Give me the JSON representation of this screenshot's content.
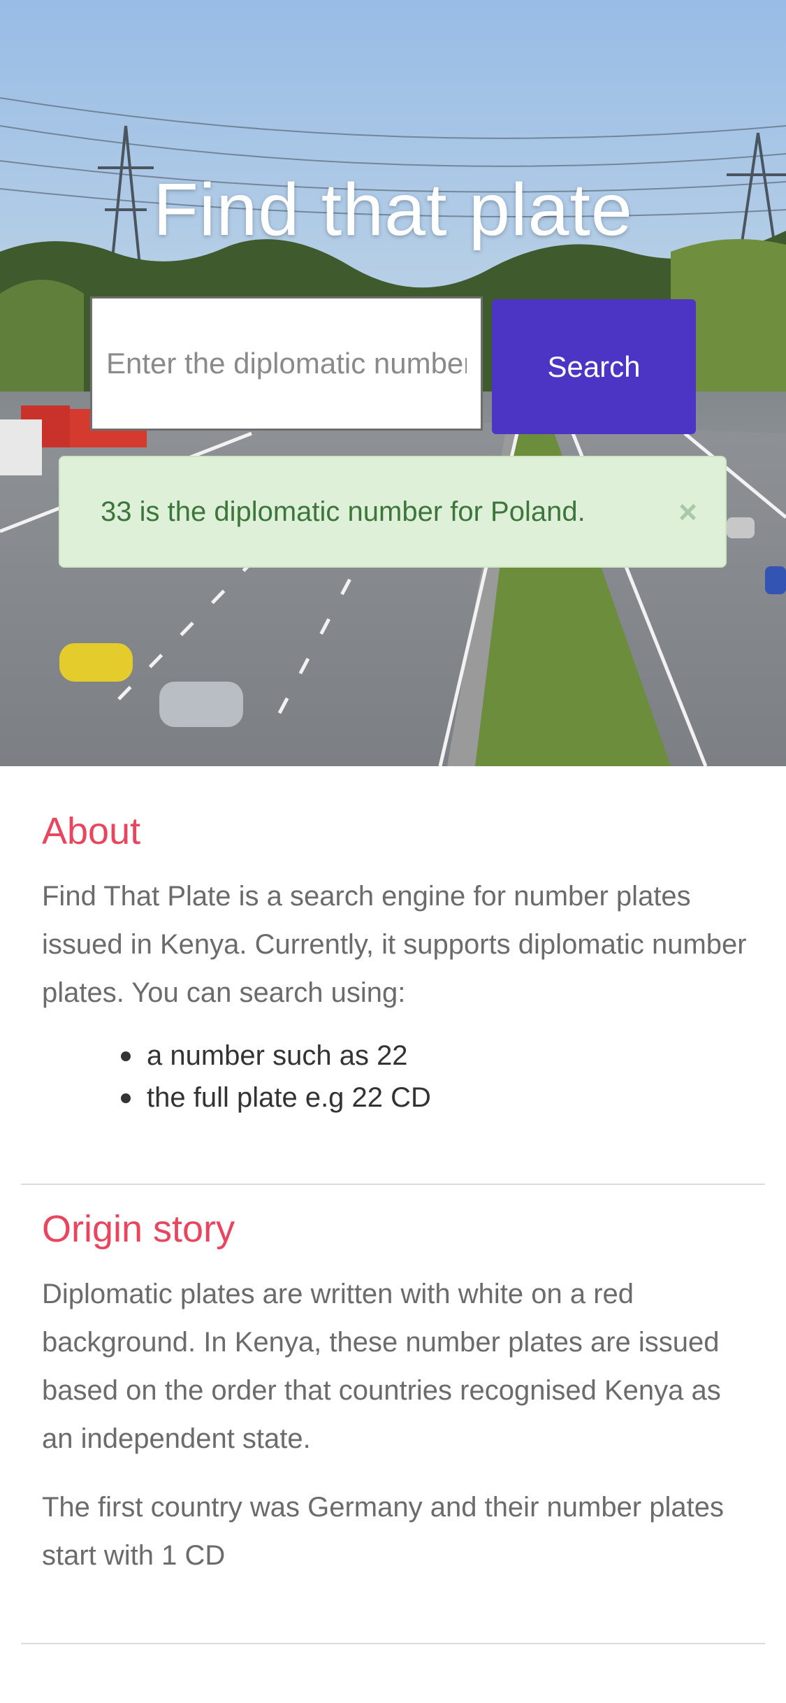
{
  "hero": {
    "title": "Find that plate",
    "search": {
      "placeholder": "Enter the diplomatic number",
      "button_label": "Search"
    },
    "alert": {
      "message": "33 is the diplomatic number for Poland.",
      "close_glyph": "×"
    }
  },
  "about": {
    "heading": "About",
    "paragraph": "Find That Plate is a search engine for number plates issued in Kenya. Currently, it supports diplomatic number plates. You can search using:",
    "items": [
      "a number such as 22",
      "the full plate e.g 22 CD"
    ]
  },
  "origin": {
    "heading": "Origin story",
    "paragraph1": "Diplomatic plates are written with white on a red background. In Kenya, these number plates are issued based on the order that countries recognised Kenya as an independent state.",
    "paragraph2": "The first country was Germany and their number plates start with 1 CD"
  },
  "colors": {
    "accent": "#e8465e",
    "button": "#4c35c4",
    "alert_bg": "#dff0d8",
    "alert_text": "#3c763d"
  }
}
